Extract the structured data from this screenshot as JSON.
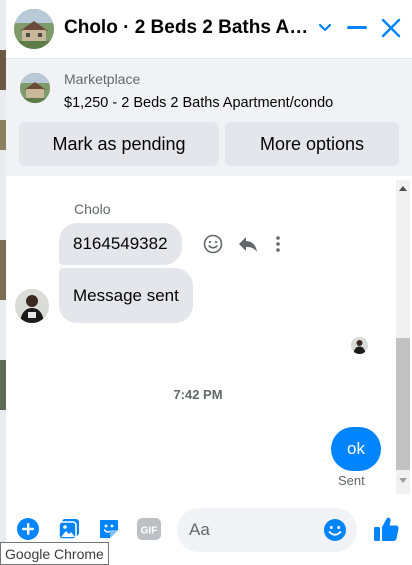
{
  "header": {
    "title": "Cholo · 2 Beds 2 Baths Apa...",
    "avatar_icon": "house-photo-avatar",
    "chevron_icon": "chevron-down-icon",
    "minimize_icon": "minimize-icon",
    "close_icon": "close-icon"
  },
  "marketplace": {
    "label": "Marketplace",
    "listing": "$1,250 - 2 Beds 2 Baths Apartment/condo",
    "mark_pending_label": "Mark as pending",
    "more_options_label": "More options"
  },
  "conversation": {
    "sender_name": "Cholo",
    "messages": [
      {
        "text": "8164549382"
      },
      {
        "text": "Message sent"
      }
    ],
    "timestamp": "7:42 PM",
    "my_message": "ok",
    "status": "Sent"
  },
  "composer": {
    "placeholder": "Aa",
    "icons": [
      "add-icon",
      "image-icon",
      "sticker-icon",
      "gif-icon",
      "emoji-icon",
      "like-icon"
    ]
  },
  "tooltip": {
    "text": "Google Chrome"
  },
  "colors": {
    "accent": "#0084ff",
    "bubble_gray": "#e4e6eb",
    "panel_gray": "#f0f2f5"
  }
}
